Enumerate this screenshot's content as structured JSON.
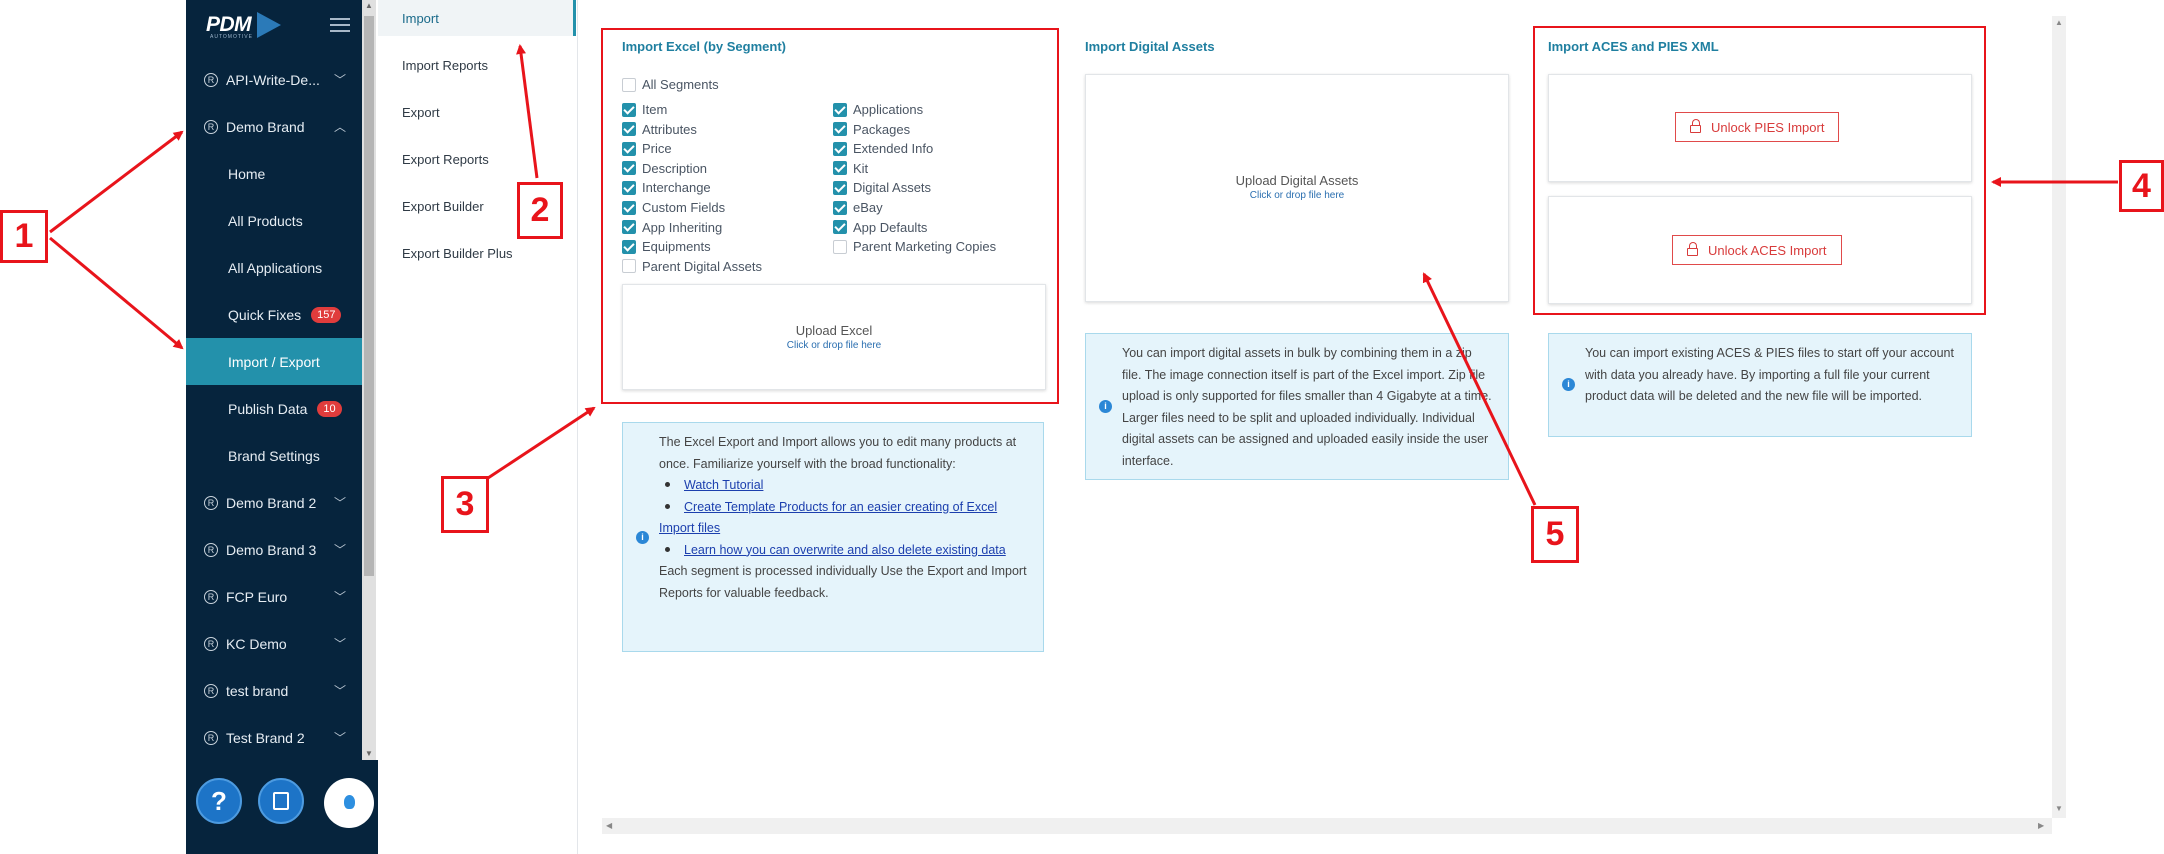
{
  "logo": {
    "brand": "PDM",
    "sub": "AUTOMOTIVE"
  },
  "sidebar": {
    "items": [
      {
        "label": "API-Write-De...",
        "type": "brand",
        "chevron": "down"
      },
      {
        "label": "Demo Brand",
        "type": "brand",
        "chevron": "up"
      },
      {
        "label": "Home",
        "type": "sub"
      },
      {
        "label": "All Products",
        "type": "sub"
      },
      {
        "label": "All Applications",
        "type": "sub"
      },
      {
        "label": "Quick Fixes",
        "type": "sub",
        "badge": "157"
      },
      {
        "label": "Import / Export",
        "type": "sub",
        "active": true
      },
      {
        "label": "Publish Data",
        "type": "sub",
        "badge": "10"
      },
      {
        "label": "Brand Settings",
        "type": "sub"
      },
      {
        "label": "Demo Brand 2",
        "type": "brand",
        "chevron": "down"
      },
      {
        "label": "Demo Brand 3",
        "type": "brand",
        "chevron": "down"
      },
      {
        "label": "FCP Euro",
        "type": "brand",
        "chevron": "down"
      },
      {
        "label": "KC Demo",
        "type": "brand",
        "chevron": "down"
      },
      {
        "label": "test brand",
        "type": "brand",
        "chevron": "down"
      },
      {
        "label": "Test Brand 2",
        "type": "brand",
        "chevron": "down"
      }
    ]
  },
  "bottom": {
    "help_label": "?"
  },
  "submenu": {
    "items": [
      {
        "label": "Import",
        "active": true
      },
      {
        "label": "Import Reports"
      },
      {
        "label": "Export"
      },
      {
        "label": "Export Reports"
      },
      {
        "label": "Export Builder"
      },
      {
        "label": "Export Builder Plus"
      }
    ]
  },
  "excel": {
    "title": "Import Excel (by Segment)",
    "all_segments": "All Segments",
    "left": [
      {
        "label": "Item",
        "checked": true
      },
      {
        "label": "Attributes",
        "checked": true
      },
      {
        "label": "Price",
        "checked": true
      },
      {
        "label": "Description",
        "checked": true
      },
      {
        "label": "Interchange",
        "checked": true
      },
      {
        "label": "Custom Fields",
        "checked": true
      },
      {
        "label": "App Inheriting",
        "checked": true
      },
      {
        "label": "Equipments",
        "checked": true
      },
      {
        "label": "Parent Digital Assets",
        "checked": false
      }
    ],
    "right": [
      {
        "label": "Applications",
        "checked": true
      },
      {
        "label": "Packages",
        "checked": true
      },
      {
        "label": "Extended Info",
        "checked": true
      },
      {
        "label": "Kit",
        "checked": true
      },
      {
        "label": "Digital Assets",
        "checked": true
      },
      {
        "label": "eBay",
        "checked": true
      },
      {
        "label": "App Defaults",
        "checked": true
      },
      {
        "label": "Parent Marketing Copies",
        "checked": false
      }
    ],
    "upload_title": "Upload Excel",
    "upload_sub": "Click or drop file here",
    "info_intro": "The Excel Export and Import allows you to edit many products at once. Familiarize yourself with the broad functionality:",
    "link1": "Watch Tutorial",
    "link2": "Create Template Products for an easier creating of Excel Import files",
    "link3": "Learn how you can overwrite and also delete existing data",
    "info_outro": "Each segment is processed individually Use the Export and Import Reports for valuable feedback."
  },
  "digital": {
    "title": "Import Digital Assets",
    "upload_title": "Upload Digital Assets",
    "upload_sub": "Click or drop file here",
    "info": "You can import digital assets in bulk by combining them in a zip file. The image connection itself is part of the Excel import. Zip file upload is only supported for files smaller than 4 Gigabyte at a time. Larger files need to be split and uploaded individually. Individual digital assets can be assigned and uploaded easily inside the user interface."
  },
  "aces": {
    "title": "Import ACES and PIES XML",
    "pies_button": "Unlock PIES Import",
    "aces_button": "Unlock ACES Import",
    "info": "You can import existing ACES & PIES files to start off your account with data you already have. By importing a full file your current product data will be deleted and the new file will be imported."
  },
  "annotations": [
    "1",
    "2",
    "3",
    "4",
    "5"
  ],
  "colors": {
    "accent": "#2391ab",
    "sidebar_bg": "#06243d",
    "annotation_red": "#e8141b",
    "badge_red": "#e03c3c"
  }
}
